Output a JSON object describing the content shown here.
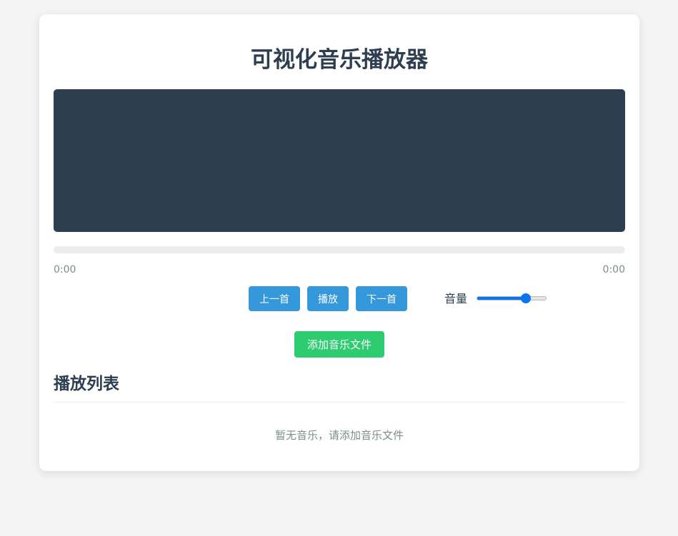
{
  "app": {
    "title": "可视化音乐播放器"
  },
  "player": {
    "current_time": "0:00",
    "duration": "0:00",
    "progress": 0
  },
  "controls": {
    "prev_label": "上一首",
    "play_label": "播放",
    "next_label": "下一首",
    "volume_label": "音量",
    "volume": 0.7
  },
  "actions": {
    "add_label": "添加音乐文件"
  },
  "playlist": {
    "title": "播放列表",
    "empty_message": "暂无音乐，请添加音乐文件",
    "items": []
  },
  "colors": {
    "primary": "#3498db",
    "success": "#2ecc71",
    "visualizer_bg": "#2d3e50",
    "heading": "#2c3e50",
    "muted": "#7f8c8d",
    "slider_accent": "#0b75ee"
  }
}
